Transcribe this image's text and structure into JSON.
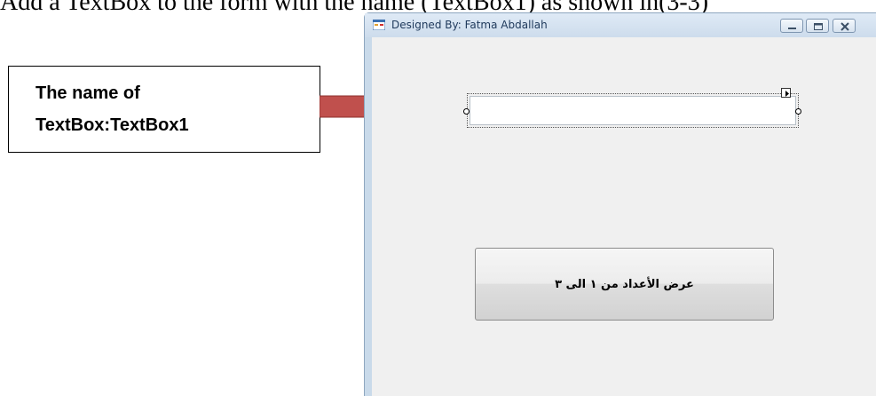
{
  "document": {
    "heading": "Add a TextBox to the form with the name (TextBox1) as shown in(3-3)"
  },
  "callout": {
    "line1": "The name of",
    "line2": "TextBox:TextBox1"
  },
  "window": {
    "title": "Designed By: Fatma Abdallah",
    "caption_buttons": [
      "minimize-icon",
      "maximize-icon",
      "close-icon"
    ]
  },
  "form": {
    "textbox_value": "",
    "button_label": "عرض الأعداد من ١ الى ٣"
  },
  "colors": {
    "arrow": "#c0504d",
    "window_frame": "#c9daea",
    "client_area": "#f0f0f0"
  }
}
